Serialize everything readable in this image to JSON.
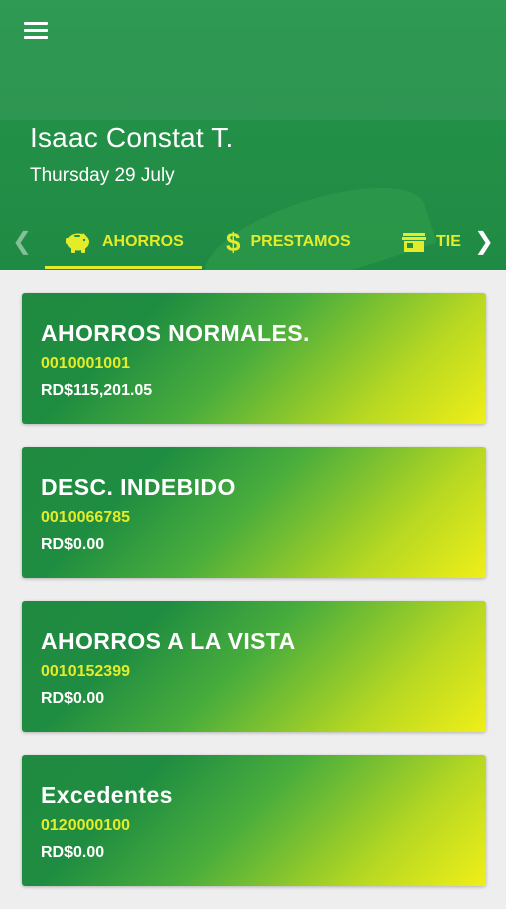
{
  "header": {
    "user_name": "Isaac Constat T.",
    "date": "Thursday 29 July"
  },
  "tabs": [
    {
      "label": "AHORROS",
      "icon": "piggy-bank-icon",
      "active": true
    },
    {
      "label": "PRESTAMOS",
      "icon": "dollar-icon",
      "active": false
    },
    {
      "label": "TIE",
      "icon": "store-icon",
      "active": false
    }
  ],
  "accounts": [
    {
      "title": "AHORROS NORMALES.",
      "number": "0010001001",
      "balance": "RD$115,201.05"
    },
    {
      "title": "DESC. INDEBIDO",
      "number": "0010066785",
      "balance": "RD$0.00"
    },
    {
      "title": "AHORROS A LA VISTA",
      "number": "0010152399",
      "balance": "RD$0.00"
    },
    {
      "title": "Excedentes",
      "number": "0120000100",
      "balance": "RD$0.00"
    }
  ],
  "colors": {
    "header_green": "#239048",
    "accent_yellow": "#e4ec2a",
    "background": "#eeeeee"
  }
}
